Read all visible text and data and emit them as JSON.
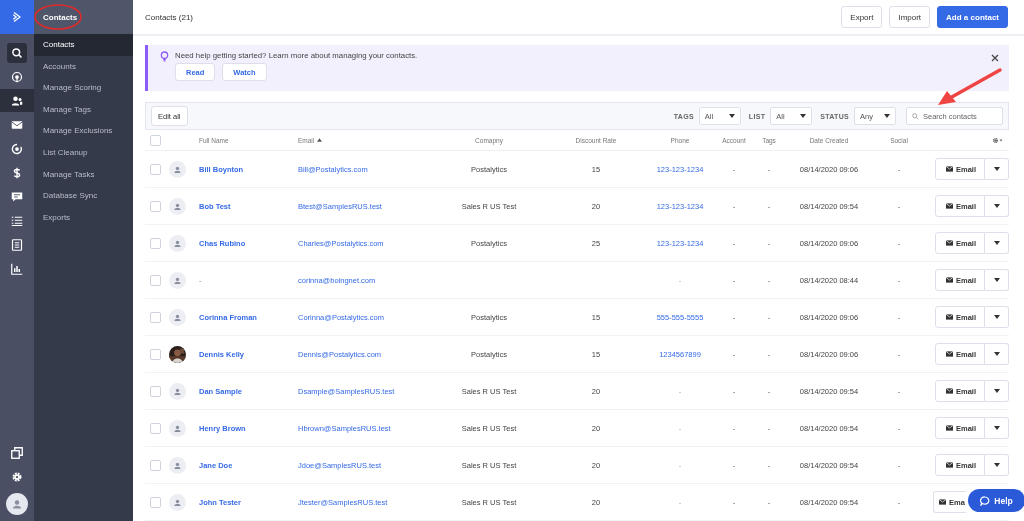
{
  "rail": {
    "items": [
      {
        "selected": false
      },
      {
        "selected": false
      },
      {
        "selected": true
      },
      {
        "selected": false
      },
      {
        "selected": false
      },
      {
        "selected": false
      },
      {
        "selected": false
      },
      {
        "selected": false
      },
      {
        "selected": false
      },
      {
        "selected": false
      }
    ]
  },
  "sidebar": {
    "title": "Contacts",
    "items": [
      {
        "label": "Contacts",
        "selected": true
      },
      {
        "label": "Accounts",
        "selected": false
      },
      {
        "label": "Manage Scoring",
        "selected": false
      },
      {
        "label": "Manage Tags",
        "selected": false
      },
      {
        "label": "Manage Exclusions",
        "selected": false
      },
      {
        "label": "List Cleanup",
        "selected": false
      },
      {
        "label": "Manage Tasks",
        "selected": false
      },
      {
        "label": "Database Sync",
        "selected": false
      },
      {
        "label": "Exports",
        "selected": false
      }
    ]
  },
  "header": {
    "title": "Contacts (21)",
    "buttons": [
      {
        "label": "Export",
        "kind": "plain"
      },
      {
        "label": "Import",
        "kind": "plain"
      },
      {
        "label": "Add a contact",
        "kind": "primary"
      }
    ]
  },
  "banner": {
    "text": "Need help getting started? Learn more about managing your contacts.",
    "buttons": [
      "Read",
      "Watch"
    ]
  },
  "toolbar": {
    "edit_all": "Edit all",
    "filters": [
      {
        "label": "TAGS",
        "value": "All"
      },
      {
        "label": "LIST",
        "value": "All"
      },
      {
        "label": "STATUS",
        "value": "Any"
      }
    ],
    "search": {
      "placeholder": "Search contacts"
    }
  },
  "table": {
    "select_all": {
      "checked": false
    },
    "columns": [
      {
        "label": "Full Name",
        "sorted": false
      },
      {
        "label": "Email",
        "sorted": true
      },
      {
        "label": "Comapny",
        "sorted": false
      },
      {
        "label": "Discount Rate",
        "sorted": false
      },
      {
        "label": "Phone",
        "sorted": false
      },
      {
        "label": "Account",
        "sorted": false
      },
      {
        "label": "Tags",
        "sorted": false
      },
      {
        "label": "Date Created",
        "sorted": false
      },
      {
        "label": "Social",
        "sorted": false
      }
    ],
    "rows": [
      {
        "kind": "placeholder",
        "checked": false,
        "name": {
          "text": "Bill Boynton",
          "link": true
        },
        "email": "Bill@Postalytics.com",
        "company": "Postalytics",
        "discount_rate": "15",
        "phone": {
          "text": "123-123-1234",
          "link": true
        },
        "account": "-",
        "tags": "-",
        "date_created": "08/14/2020 09:06",
        "social": "-",
        "action": "Email"
      },
      {
        "kind": "placeholder",
        "checked": false,
        "name": {
          "text": "Bob Test",
          "link": true
        },
        "email": "Btest@SamplesRUS.test",
        "company": "Sales R US Test",
        "discount_rate": "20",
        "phone": {
          "text": "123-123-1234",
          "link": true
        },
        "account": "-",
        "tags": "-",
        "date_created": "08/14/2020 09:54",
        "social": "-",
        "action": "Email"
      },
      {
        "kind": "placeholder",
        "checked": false,
        "name": {
          "text": "Chas Rubino",
          "link": true
        },
        "email": "Charles@Postalytics.com",
        "company": "Postalytics",
        "discount_rate": "25",
        "phone": {
          "text": "123-123-1234",
          "link": true
        },
        "account": "-",
        "tags": "-",
        "date_created": "08/14/2020 09:06",
        "social": "-",
        "action": "Email"
      },
      {
        "kind": "placeholder",
        "checked": false,
        "name": {
          "text": "-",
          "link": false
        },
        "email": "corinna@boingnet.com",
        "company": "",
        "discount_rate": "",
        "phone": {
          "text": "-"
        },
        "account": "-",
        "tags": "-",
        "date_created": "08/14/2020 08:44",
        "social": "-",
        "action": "Email"
      },
      {
        "kind": "placeholder",
        "checked": false,
        "name": {
          "text": "Corinna Froman",
          "link": true
        },
        "email": "Corinna@Postalytics.com",
        "company": "Postalytics",
        "discount_rate": "15",
        "phone": {
          "text": "555-555-5555",
          "link": true
        },
        "account": "-",
        "tags": "-",
        "date_created": "08/14/2020 09:06",
        "social": "-",
        "action": "Email"
      },
      {
        "checked": false,
        "name": {
          "text": "Dennis Kelly",
          "link": true
        },
        "email": "Dennis@Postalytics.com",
        "company": "Postalytics",
        "discount_rate": "15",
        "phone": {
          "text": "1234567899",
          "link": true
        },
        "account": "-",
        "tags": "-",
        "date_created": "08/14/2020 09:06",
        "social": "-",
        "action": "Email"
      },
      {
        "kind": "placeholder",
        "checked": false,
        "name": {
          "text": "Dan Sample",
          "link": true
        },
        "email": "Dsample@SamplesRUS.test",
        "company": "Sales R US Test",
        "discount_rate": "20",
        "phone": {
          "text": "-"
        },
        "account": "-",
        "tags": "-",
        "date_created": "08/14/2020 09:54",
        "social": "-",
        "action": "Email"
      },
      {
        "kind": "placeholder",
        "checked": false,
        "name": {
          "text": "Henry Brown",
          "link": true
        },
        "email": "Hbrown@SamplesRUS.test",
        "company": "Sales R US Test",
        "discount_rate": "20",
        "phone": {
          "text": "-"
        },
        "account": "-",
        "tags": "-",
        "date_created": "08/14/2020 09:54",
        "social": "-",
        "action": "Email"
      },
      {
        "kind": "placeholder",
        "checked": false,
        "name": {
          "text": "Jane Doe",
          "link": true
        },
        "email": "Jdoe@SamplesRUS.test",
        "company": "Sales R US Test",
        "discount_rate": "20",
        "phone": {
          "text": "-"
        },
        "account": "-",
        "tags": "-",
        "date_created": "08/14/2020 09:54",
        "social": "-",
        "action": "Email"
      },
      {
        "kind": "placeholder",
        "checked": false,
        "name": {
          "text": "John Tester",
          "link": true
        },
        "email": "Jtester@SamplesRUS.test",
        "company": "Sales R US Test",
        "discount_rate": "20",
        "phone": {
          "text": "-"
        },
        "account": "-",
        "tags": "-",
        "date_created": "08/14/2020 09:54",
        "social": "-",
        "action": "Ema"
      }
    ]
  },
  "help": {
    "label": "Help"
  }
}
